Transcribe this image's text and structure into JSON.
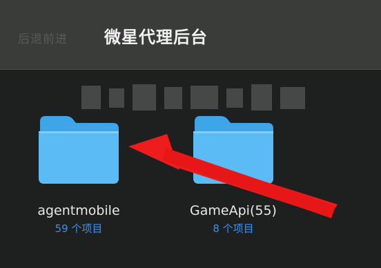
{
  "toolbar": {
    "nav_label": "后退前进",
    "title": "微星代理后台"
  },
  "folders": [
    {
      "name": "agentmobile",
      "count": "59 个项目"
    },
    {
      "name": "GameApi(55)",
      "count": "8 个项目"
    }
  ],
  "colors": {
    "folder_body": "#5bbcf5",
    "folder_tab": "#3ea5e8",
    "count_text": "#3d8ff0",
    "annotation_arrow": "#ee1c1c"
  },
  "icons": {
    "folder": "folder-icon",
    "annotation": "red-arrow-annotation"
  }
}
